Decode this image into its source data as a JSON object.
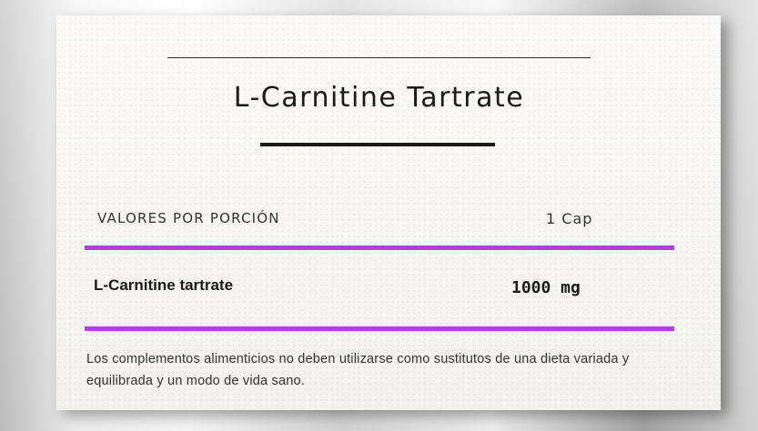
{
  "label": {
    "title": "L-Carnitine Tartrate",
    "table": {
      "header_label": "VALORES POR PORCIÓN",
      "header_serving": "1 Cap",
      "rows": [
        {
          "name": "L-Carnitine tartrate",
          "amount": "1000 mg"
        }
      ]
    },
    "disclaimer": "Los complementos alimenticios no deben utilizarse como sustitutos de una dieta variada y equilibrada y un modo de vida sano."
  },
  "colors": {
    "accent": "#b33de6",
    "text": "#1a1a1a",
    "card": "#f7f6f3"
  }
}
